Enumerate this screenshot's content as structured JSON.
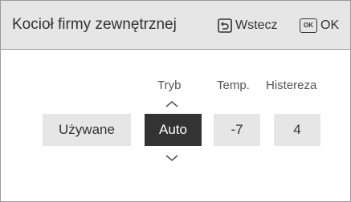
{
  "header": {
    "title": "Kocioł firmy zewnętrznej",
    "back_label": "Wstecz",
    "ok_icon_text": "OK",
    "ok_label": "OK"
  },
  "columns": {
    "mode_label": "Tryb",
    "temp_label": "Temp.",
    "hysteresis_label": "Histereza"
  },
  "values": {
    "status": "Używane",
    "mode": "Auto",
    "temp": "-7",
    "hysteresis": "4"
  },
  "icons": {
    "back": "back-arrow-icon",
    "ok": "ok-icon",
    "up": "chevron-up-icon",
    "down": "chevron-down-icon"
  },
  "colors": {
    "header_bg": "#e6e6e6",
    "tile_bg": "#e6e6e6",
    "selected_bg": "#333333",
    "selected_text": "#ffffff",
    "text": "#333333"
  }
}
